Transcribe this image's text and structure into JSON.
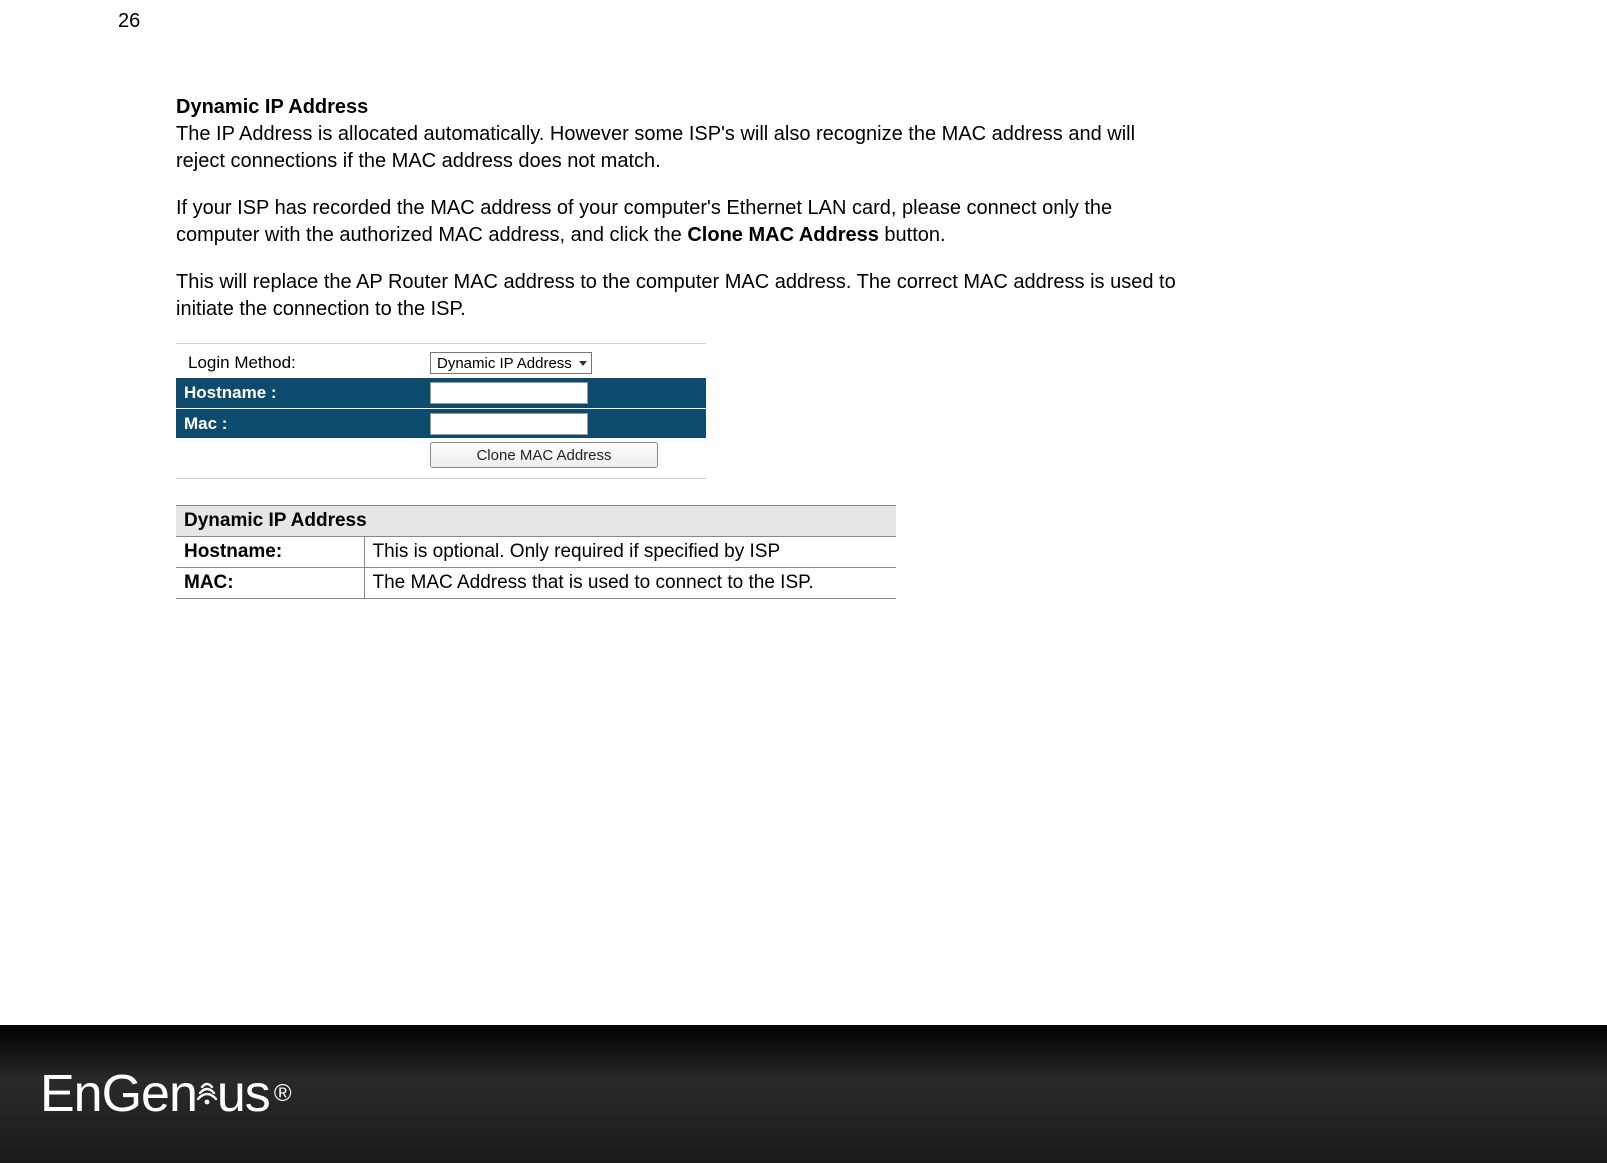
{
  "page_number": "26",
  "heading": "Dynamic IP Address",
  "para1": "The IP Address is allocated automatically. However some ISP's will also recognize the MAC address and will reject connections if the MAC address does not match.",
  "para2_a": "If your ISP has recorded the MAC address of your computer's Ethernet LAN card, please connect only the computer with the authorized MAC address, and click the ",
  "para2_bold": "Clone MAC Address",
  "para2_b": " button.",
  "para3": "This will replace the AP Router MAC address to the computer MAC address. The correct MAC address is used to initiate the connection to the ISP.",
  "form": {
    "login_method_label": "Login Method:",
    "login_method_value": "Dynamic IP Address",
    "hostname_label": "Hostname :",
    "hostname_value": "",
    "mac_label": "Mac :",
    "mac_value": "",
    "clone_button": "Clone MAC Address"
  },
  "table": {
    "header": "Dynamic IP Address",
    "rows": [
      {
        "key": "Hostname:",
        "val": "This is optional. Only required if specified by ISP"
      },
      {
        "key": "MAC:",
        "val": "The MAC Address that is used to connect to the ISP."
      }
    ]
  },
  "brand_a": "EnGen",
  "brand_b": "us"
}
